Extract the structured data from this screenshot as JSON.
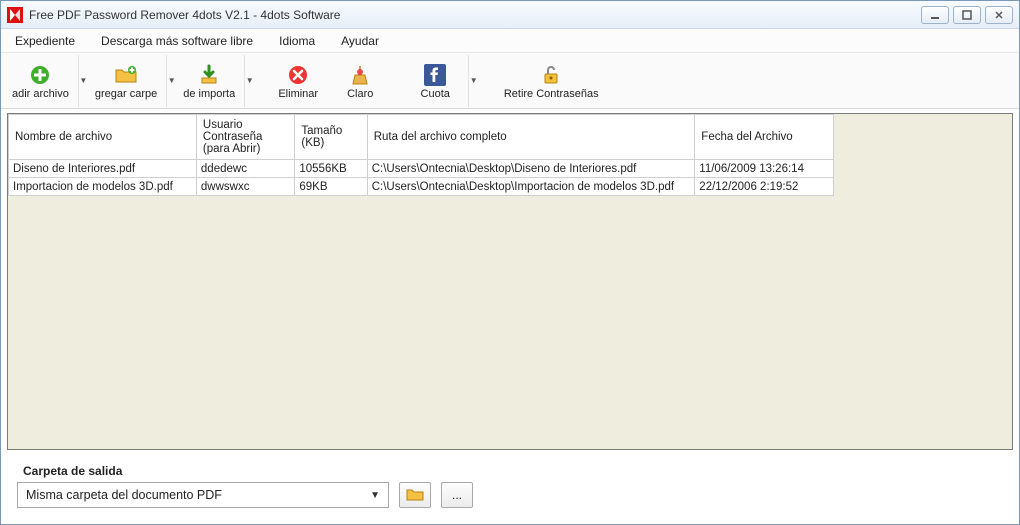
{
  "window": {
    "title": "Free PDF Password Remover 4dots V2.1 - 4dots Software"
  },
  "menu": {
    "items": [
      "Expediente",
      "Descarga más software libre",
      "Idioma",
      "Ayudar"
    ]
  },
  "toolbar": {
    "add_file": "adir archivo",
    "add_folder": "gregar carpe",
    "import": "de importa",
    "delete": "Eliminar",
    "clear": "Claro",
    "share": "Cuota",
    "remove_pw": "Retire Contraseñas"
  },
  "grid": {
    "headers": {
      "filename": "Nombre de archivo",
      "user_pw": "Usuario Contraseña (para Abrir)",
      "size": "Tamaño (KB)",
      "fullpath": "Ruta del archivo completo",
      "filedate": "Fecha del Archivo"
    },
    "rows": [
      {
        "filename": "Diseno de Interiores.pdf",
        "user_pw": "ddedewc",
        "size": "10556KB",
        "fullpath": "C:\\Users\\Ontecnia\\Desktop\\Diseno de Interiores.pdf",
        "filedate": "11/06/2009 13:26:14"
      },
      {
        "filename": "Importacion de modelos 3D.pdf",
        "user_pw": "dwwswxc",
        "size": "69KB",
        "fullpath": "C:\\Users\\Ontecnia\\Desktop\\Importacion de modelos 3D.pdf",
        "filedate": "22/12/2006 2:19:52"
      }
    ]
  },
  "output": {
    "label": "Carpeta de salida",
    "combo_value": "Misma carpeta del documento PDF",
    "browse_more": "..."
  }
}
